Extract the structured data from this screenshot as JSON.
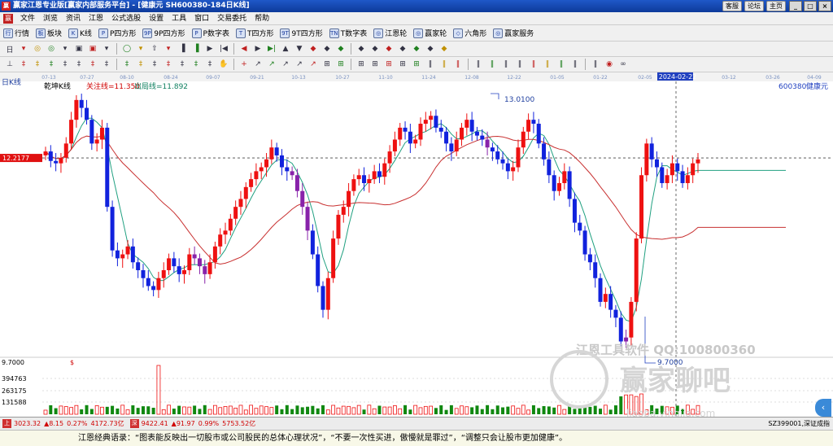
{
  "titlebar": {
    "logo": "赢",
    "title": "赢家江恩专业版[赢家内部服务平台] - [健康元  SH600380-184日K线]",
    "links": [
      "客服",
      "论坛",
      "主页"
    ],
    "controls": [
      "_",
      "□",
      "×"
    ]
  },
  "menubar": {
    "logo": "赢",
    "items": [
      "文件",
      "浏览",
      "资讯",
      "江恩",
      "公式选股",
      "设置",
      "工具",
      "窗口",
      "交易委托",
      "帮助"
    ]
  },
  "toolbar1": {
    "items": [
      {
        "icon": "行",
        "label": "行情"
      },
      {
        "icon": "板",
        "label": "板块"
      },
      {
        "icon": "K",
        "label": "K线"
      },
      {
        "icon": "P",
        "label": "P四方形"
      },
      {
        "icon": "9P",
        "label": "9P四方形"
      },
      {
        "icon": "P",
        "label": "P数字表"
      },
      {
        "icon": "T",
        "label": "T四方形"
      },
      {
        "icon": "9T",
        "label": "9T四方形"
      },
      {
        "icon": "TN",
        "label": "T数字表"
      },
      {
        "icon": "◎",
        "label": "江恩轮"
      },
      {
        "icon": "◎",
        "label": "赢家轮"
      },
      {
        "icon": "◇",
        "label": "六角形"
      },
      {
        "icon": "◎",
        "label": "赢家服务"
      }
    ]
  },
  "toolbar2": {
    "icons": [
      "日",
      "▾",
      "◎",
      "◎",
      "▾",
      "▣",
      "▣",
      "▾",
      "◯",
      "▾",
      "⇧",
      "▾",
      "▐",
      "▐",
      "▶",
      "|◀",
      "◀",
      "▶",
      "▶|",
      "▲",
      "▼",
      "◆",
      "◆",
      "◆",
      "◆",
      "◆",
      "◆",
      "◆",
      "◆",
      "◆",
      "◆"
    ]
  },
  "toolbar3": {
    "icons": [
      "⊥",
      "‡",
      "‡",
      "‡",
      "‡",
      "‡",
      "‡",
      "‡",
      "‡",
      "‡",
      "‡",
      "‡",
      "‡",
      "‡",
      "‡",
      "✋",
      "+",
      "↗",
      "↗",
      "↗",
      "↗",
      "↗",
      "⊞",
      "⊞",
      "⊞",
      "⊞",
      "⊞",
      "⊞",
      "⊞",
      "‖",
      "‖",
      "‖",
      "‖",
      "‖",
      "‖",
      "‖",
      "‖",
      "‖",
      "‖",
      "‖",
      "‖",
      "◉",
      "∞"
    ]
  },
  "chart": {
    "period_label": "日K线",
    "indicator_label": "乾坤K线",
    "focus_line_label": "关注线=11.350",
    "exit_line_label": "出局线=11.892",
    "stock_code": "600380",
    "stock_name": "健康元",
    "dates": [
      "07-13",
      "07-27",
      "08-10",
      "08-24",
      "09-07",
      "09-21",
      "10-13",
      "10-27",
      "11-10",
      "11-24",
      "12-08",
      "12-22",
      "01-05",
      "01-22",
      "02-05",
      "2024-02-22",
      "03-12",
      "03-26",
      "04-09"
    ],
    "current_price_label": "12.2177",
    "high_label": "13.0100",
    "low_label": "9.7000",
    "volume_top_label": "9.7000",
    "volume_ticks": [
      "394763",
      "263175",
      "131588"
    ],
    "watermark_line1": "江恩工具软件  QQ:100800360",
    "watermark_line2": "赢家聊吧",
    "watermark_line3": "liaoba.yingjia.com"
  },
  "colors": {
    "up": "#ee1111",
    "down": "#1122dd",
    "purple": "#8822aa",
    "ma_red": "#c83030",
    "ma_green": "#20a080"
  },
  "status_bar": {
    "index1": "3023.32",
    "index1_chg": "▲8.15",
    "index1_pct": "0.27%",
    "index1_amt": "4172.73亿",
    "index2": "9422.41",
    "index2_chg": "▲91.97",
    "index2_pct": "0.99%",
    "index2_amt": "5753.52亿",
    "right_label": "SZ399001,深证成指"
  },
  "quote_bar": {
    "text": "江恩经典语录：“图表能反映出一切股市或公司股民的总体心理状况”，“不要一次性买进，傲慢就是罪过”，“调整只会让股市更加健康”。"
  }
}
